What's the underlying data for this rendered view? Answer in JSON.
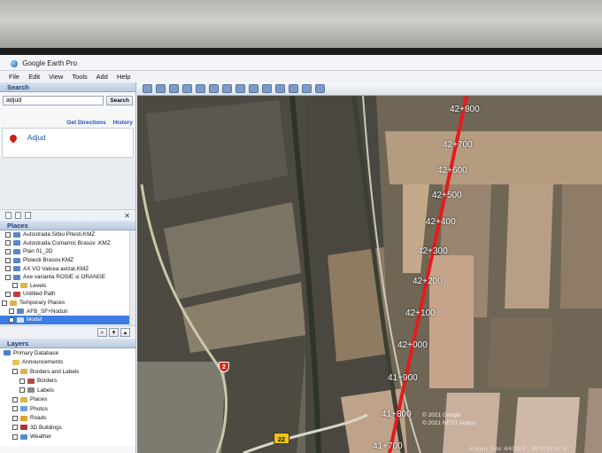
{
  "window": {
    "title": "Google Earth Pro"
  },
  "menu": [
    "File",
    "Edit",
    "View",
    "Tools",
    "Add",
    "Help"
  ],
  "search": {
    "header": "Search",
    "value": "adjud",
    "button": "Search",
    "get_directions": "Get Directions",
    "history": "History",
    "result": "Adjud"
  },
  "places": {
    "header": "Places",
    "items": [
      "Autostrada Sibiu Pitesti.KMZ",
      "Autostrada Comarnic Brasov .KMZ",
      "Plan 01_2D",
      "Ploiesti Brasov.KMZ",
      "AX VO Valcea avizat.KMZ",
      "Axe varianta ROSIE si ORANGE",
      "Levels",
      "Untitled Path",
      "Temporary Places",
      "AFB_SF+Noduri",
      "Model"
    ]
  },
  "layers": {
    "header": "Layers",
    "items": [
      "Primary Database",
      "Announcements",
      "Borders and Labels",
      "Borders",
      "Labels",
      "Places",
      "Photos",
      "Roads",
      "3D Buildings",
      "Weather"
    ]
  },
  "map": {
    "chainage_labels": [
      "42+800",
      "42+700",
      "42+600",
      "42+500",
      "42+400",
      "42+300",
      "42+200",
      "42+100",
      "42+000",
      "41+900",
      "41+800",
      "41+700"
    ],
    "road_shields": [
      "2",
      "22"
    ],
    "attribution_1": "© 2021 Google",
    "attribution_2": "© 2021 NEST Airbus",
    "status_left": "Imagery Date: 6/4/2018",
    "status_right": "46°01'49.46\" N"
  },
  "colors": {
    "route_line": "#e51b1b",
    "panel_header": "#1c3f7a",
    "link_blue": "#1f52b5",
    "selection": "#3d7ce2"
  }
}
